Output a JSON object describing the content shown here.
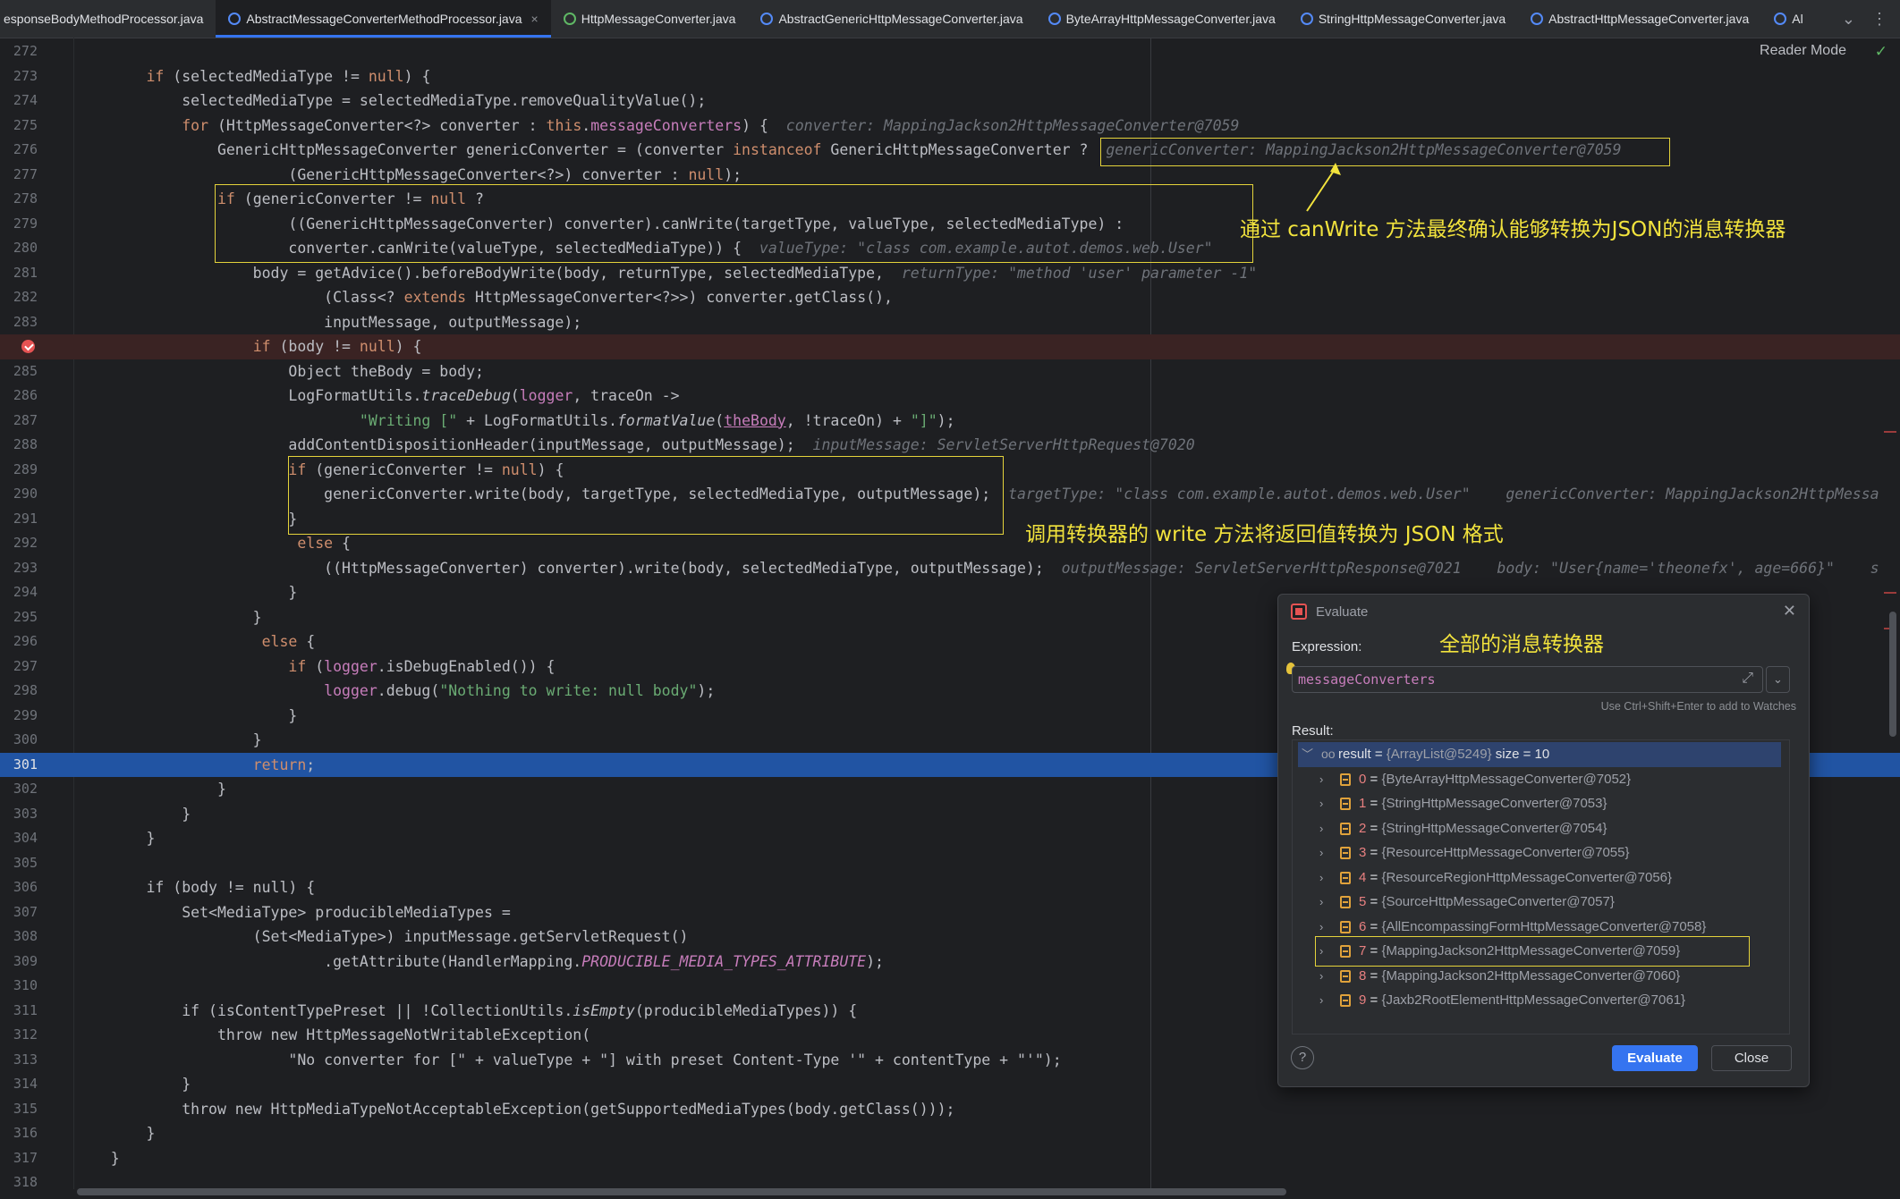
{
  "tabs": [
    {
      "label": "esponseBodyMethodProcessor.java",
      "icon": "none"
    },
    {
      "label": "AbstractMessageConverterMethodProcessor.java",
      "icon": "class-icon",
      "active": true,
      "close": "×"
    },
    {
      "label": "HttpMessageConverter.java",
      "icon": "interface-icon"
    },
    {
      "label": "AbstractGenericHttpMessageConverter.java",
      "icon": "class-icon"
    },
    {
      "label": "ByteArrayHttpMessageConverter.java",
      "icon": "class-icon"
    },
    {
      "label": "StringHttpMessageConverter.java",
      "icon": "class-icon"
    },
    {
      "label": "AbstractHttpMessageConverter.java",
      "icon": "class-icon"
    },
    {
      "label": "Al",
      "icon": "class-icon"
    }
  ],
  "tab_tools": {
    "dropdown": "⌄",
    "more": "⋮"
  },
  "editor": {
    "reader_mode": "Reader Mode",
    "check": "✓",
    "lines": [
      {
        "n": "272",
        "segs": []
      },
      {
        "n": "273",
        "segs": [
          [
            "t",
            "        "
          ],
          [
            "kw",
            "if"
          ],
          [
            "t",
            " (selectedMediaType != "
          ],
          [
            "kw",
            "null"
          ],
          [
            "t",
            ") {"
          ]
        ]
      },
      {
        "n": "274",
        "segs": [
          [
            "t",
            "            selectedMediaType = selectedMediaType.removeQualityValue();"
          ]
        ]
      },
      {
        "n": "275",
        "segs": [
          [
            "t",
            "            "
          ],
          [
            "kw",
            "for"
          ],
          [
            "t",
            " (HttpMessageConverter<?> converter : "
          ],
          [
            "kw",
            "this"
          ],
          [
            "t",
            "."
          ],
          [
            "fld",
            "messageConverters"
          ],
          [
            "t",
            ") {  "
          ],
          [
            "hint",
            "converter: MappingJackson2HttpMessageConverter@7059"
          ]
        ]
      },
      {
        "n": "276",
        "segs": [
          [
            "t",
            "                GenericHttpMessageConverter genericConverter = (converter "
          ],
          [
            "kw",
            "instanceof"
          ],
          [
            "t",
            " GenericHttpMessageConverter ?  "
          ],
          [
            "hint",
            "genericConverter: MappingJackson2HttpMessageConverter@7059"
          ]
        ]
      },
      {
        "n": "277",
        "segs": [
          [
            "t",
            "                        (GenericHttpMessageConverter<?>) converter : "
          ],
          [
            "kw",
            "null"
          ],
          [
            "t",
            ");"
          ]
        ]
      },
      {
        "n": "278",
        "segs": [
          [
            "t",
            "                "
          ],
          [
            "kw",
            "if"
          ],
          [
            "t",
            " (genericConverter != "
          ],
          [
            "kw",
            "null"
          ],
          [
            "t",
            " ?"
          ]
        ]
      },
      {
        "n": "279",
        "segs": [
          [
            "t",
            "                        ((GenericHttpMessageConverter) converter).canWrite(targetType, valueType, selectedMediaType) :"
          ]
        ]
      },
      {
        "n": "280",
        "segs": [
          [
            "t",
            "                        converter.canWrite(valueType, selectedMediaType)) {  "
          ],
          [
            "hint",
            "valueType: \"class com.example.autot.demos.web.User\""
          ]
        ]
      },
      {
        "n": "281",
        "segs": [
          [
            "t",
            "                    body = getAdvice().beforeBodyWrite(body, returnType, selectedMediaType,  "
          ],
          [
            "hint",
            "returnType: \"method 'user' parameter -1\""
          ]
        ]
      },
      {
        "n": "282",
        "segs": [
          [
            "t",
            "                            (Class<? "
          ],
          [
            "kw",
            "extends"
          ],
          [
            "t",
            " HttpMessageConverter<?>>) converter.getClass(),"
          ]
        ]
      },
      {
        "n": "283",
        "segs": [
          [
            "t",
            "                            inputMessage, outputMessage);"
          ]
        ]
      },
      {
        "n": "284",
        "bp": true,
        "segs": [
          [
            "t",
            "                    "
          ],
          [
            "kw",
            "if"
          ],
          [
            "t",
            " (body != "
          ],
          [
            "kw",
            "null"
          ],
          [
            "t",
            ") {"
          ]
        ]
      },
      {
        "n": "285",
        "segs": [
          [
            "t",
            "                        Object theBody = body;"
          ]
        ]
      },
      {
        "n": "286",
        "segs": [
          [
            "t",
            "                        LogFormatUtils."
          ],
          [
            "sfn",
            "traceDebug"
          ],
          [
            "t",
            "("
          ],
          [
            "fld",
            "logger"
          ],
          [
            "t",
            ", traceOn ->"
          ]
        ]
      },
      {
        "n": "287",
        "segs": [
          [
            "t",
            "                                "
          ],
          [
            "str",
            "\"Writing [\""
          ],
          [
            "t",
            " + LogFormatUtils."
          ],
          [
            "sfn",
            "formatValue"
          ],
          [
            "t",
            "("
          ],
          [
            "und",
            "theBody"
          ],
          [
            "t",
            ", !traceOn) + "
          ],
          [
            "str",
            "\"]\""
          ],
          [
            "t",
            ");"
          ]
        ]
      },
      {
        "n": "288",
        "segs": [
          [
            "t",
            "                        addContentDispositionHeader(inputMessage, outputMessage);  "
          ],
          [
            "hint",
            "inputMessage: ServletServerHttpRequest@7020"
          ]
        ]
      },
      {
        "n": "289",
        "segs": [
          [
            "t",
            "                        "
          ],
          [
            "kw",
            "if"
          ],
          [
            "t",
            " (genericConverter != "
          ],
          [
            "kw",
            "null"
          ],
          [
            "t",
            ") {"
          ]
        ]
      },
      {
        "n": "290",
        "segs": [
          [
            "t",
            "                            genericConverter.write(body, targetType, selectedMediaType, outputMessage);  "
          ],
          [
            "hint",
            "targetType: \"class com.example.autot.demos.web.User\"    genericConverter: MappingJackson2HttpMessa"
          ]
        ]
      },
      {
        "n": "291",
        "segs": [
          [
            "t",
            "                        }"
          ]
        ]
      },
      {
        "n": "292",
        "segs": [
          [
            "t",
            "                         "
          ],
          [
            "kw",
            "else"
          ],
          [
            "t",
            " {"
          ]
        ]
      },
      {
        "n": "293",
        "segs": [
          [
            "t",
            "                            ((HttpMessageConverter) converter).write(body, selectedMediaType, outputMessage);  "
          ],
          [
            "hint",
            "outputMessage: ServletServerHttpResponse@7021    body: \"User{name='theonefx', age=666}\"    s"
          ]
        ]
      },
      {
        "n": "294",
        "segs": [
          [
            "t",
            "                        }"
          ]
        ]
      },
      {
        "n": "295",
        "segs": [
          [
            "t",
            "                    }"
          ]
        ]
      },
      {
        "n": "296",
        "segs": [
          [
            "t",
            "                     "
          ],
          [
            "kw",
            "else"
          ],
          [
            "t",
            " {"
          ]
        ]
      },
      {
        "n": "297",
        "segs": [
          [
            "t",
            "                        "
          ],
          [
            "kw",
            "if"
          ],
          [
            "t",
            " ("
          ],
          [
            "fld",
            "logger"
          ],
          [
            "t",
            ".isDebugEnabled()) {"
          ]
        ]
      },
      {
        "n": "298",
        "segs": [
          [
            "t",
            "                            "
          ],
          [
            "fld",
            "logger"
          ],
          [
            "t",
            ".debug("
          ],
          [
            "str",
            "\"Nothing to write: null body\""
          ],
          [
            "t",
            ");"
          ]
        ]
      },
      {
        "n": "299",
        "segs": [
          [
            "t",
            "                        }"
          ]
        ]
      },
      {
        "n": "300",
        "segs": [
          [
            "t",
            "                    }"
          ]
        ]
      },
      {
        "n": "301",
        "cur": true,
        "segs": [
          [
            "t",
            "                    "
          ],
          [
            "kw",
            "return"
          ],
          [
            "t",
            ";"
          ]
        ]
      },
      {
        "n": "302",
        "segs": [
          [
            "t",
            "                }"
          ]
        ]
      },
      {
        "n": "303",
        "segs": [
          [
            "t",
            "            }"
          ]
        ]
      },
      {
        "n": "304",
        "segs": [
          [
            "t",
            "        }"
          ]
        ]
      },
      {
        "n": "305",
        "segs": []
      },
      {
        "n": "306",
        "segs": [
          [
            "t",
            "        if (body != null) {"
          ]
        ]
      },
      {
        "n": "307",
        "segs": [
          [
            "t",
            "            Set<MediaType> producibleMediaTypes ="
          ]
        ]
      },
      {
        "n": "308",
        "segs": [
          [
            "t",
            "                    (Set<MediaType>) inputMessage.getServletRequest()"
          ]
        ]
      },
      {
        "n": "309",
        "segs": [
          [
            "t",
            "                            .getAttribute(HandlerMapping."
          ],
          [
            "cst",
            "PRODUCIBLE_MEDIA_TYPES_ATTRIBUTE"
          ],
          [
            "t",
            ");"
          ]
        ]
      },
      {
        "n": "310",
        "segs": []
      },
      {
        "n": "311",
        "segs": [
          [
            "t",
            "            if (isContentTypePreset || !CollectionUtils."
          ],
          [
            "sfn",
            "isEmpty"
          ],
          [
            "t",
            "(producibleMediaTypes)) {"
          ]
        ]
      },
      {
        "n": "312",
        "segs": [
          [
            "t",
            "                throw new HttpMessageNotWritableException("
          ]
        ]
      },
      {
        "n": "313",
        "segs": [
          [
            "t",
            "                        \"No converter for [\" + valueType + \"] with preset Content-Type '\" + contentType + \"'\");"
          ]
        ]
      },
      {
        "n": "314",
        "segs": [
          [
            "t",
            "            }"
          ]
        ]
      },
      {
        "n": "315",
        "segs": [
          [
            "t",
            "            throw new HttpMediaTypeNotAcceptableException(getSupportedMediaTypes(body.getClass()));"
          ]
        ]
      },
      {
        "n": "316",
        "segs": [
          [
            "t",
            "        }"
          ]
        ]
      },
      {
        "n": "317",
        "segs": [
          [
            "t",
            "    }"
          ]
        ]
      },
      {
        "n": "318",
        "segs": []
      }
    ]
  },
  "annotations": {
    "canwrite_note": "通过 canWrite 方法最终确认能够转换为JSON的消息转换器",
    "write_note": "调用转换器的 write 方法将返回值转换为 JSON 格式",
    "converters_note": "全部的消息转换器"
  },
  "evaluate_dialog": {
    "title": "Evaluate",
    "close_icon": "✕",
    "expression_label": "Expression:",
    "expression_value": "messageConverters",
    "expand_icon": "⤢",
    "dropdown_icon": "⌄",
    "watch_hint": "Use Ctrl+Shift+Enter to add to Watches",
    "result_label": "Result:",
    "result_root": {
      "name": "result",
      "eq": " = ",
      "value": "{ArrayList@5249}",
      "extra": "  size = 10"
    },
    "items": [
      {
        "name": "0",
        "value": "{ByteArrayHttpMessageConverter@7052}"
      },
      {
        "name": "1",
        "value": "{StringHttpMessageConverter@7053}"
      },
      {
        "name": "2",
        "value": "{StringHttpMessageConverter@7054}"
      },
      {
        "name": "3",
        "value": "{ResourceHttpMessageConverter@7055}"
      },
      {
        "name": "4",
        "value": "{ResourceRegionHttpMessageConverter@7056}"
      },
      {
        "name": "5",
        "value": "{SourceHttpMessageConverter@7057}"
      },
      {
        "name": "6",
        "value": "{AllEncompassingFormHttpMessageConverter@7058}"
      },
      {
        "name": "7",
        "value": "{MappingJackson2HttpMessageConverter@7059}"
      },
      {
        "name": "8",
        "value": "{MappingJackson2HttpMessageConverter@7060}"
      },
      {
        "name": "9",
        "value": "{Jaxb2RootElementHttpMessageConverter@7061}"
      }
    ],
    "help_label": "?",
    "evaluate_button": "Evaluate",
    "close_button": "Close"
  },
  "colors": {
    "keyword": "#cf8e6d",
    "field": "#c77dbb",
    "string": "#6aab73",
    "hint": "#6f737a",
    "annotation": "#f2e33d",
    "current_line": "#2154a3",
    "breakpoint": "#e55353"
  }
}
